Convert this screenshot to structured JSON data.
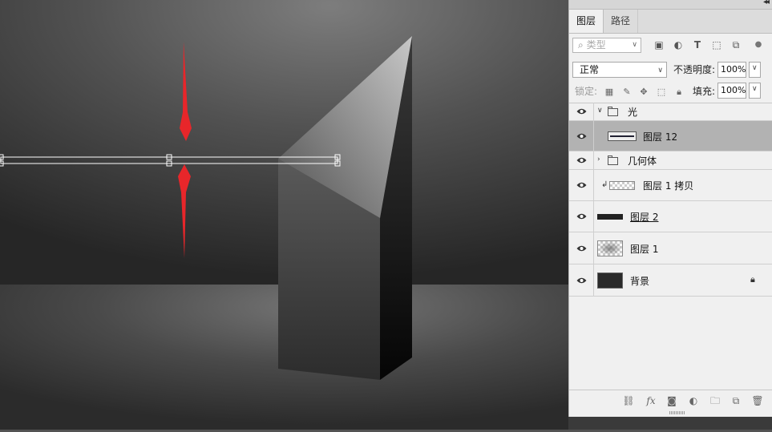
{
  "panel": {
    "tabs": [
      {
        "label": "图层",
        "active": true
      },
      {
        "label": "路径",
        "active": false
      }
    ],
    "filter": {
      "placeholder": "类型"
    },
    "blend_mode": "正常",
    "opacity_label": "不透明度:",
    "opacity_value": "100%",
    "lock_label": "锁定:",
    "fill_label": "填充:",
    "fill_value": "100%",
    "layers": [
      {
        "name": "光",
        "kind": "group",
        "expanded": true
      },
      {
        "name": "图层 12",
        "kind": "layer",
        "selected": true
      },
      {
        "name": "几何体",
        "kind": "group",
        "expanded": false
      },
      {
        "name": "图层 1 拷贝",
        "kind": "clipped-layer"
      },
      {
        "name": "图层 2",
        "kind": "layer"
      },
      {
        "name": "图层 1",
        "kind": "layer"
      },
      {
        "name": "背景",
        "kind": "background",
        "locked": true
      }
    ],
    "bottom_icons": [
      "link-icon",
      "fx-icon",
      "mask-icon",
      "adjustment-icon",
      "folder-icon",
      "new-layer-icon",
      "trash-icon"
    ]
  },
  "colors": {
    "annotation_arrow": "#e8262a",
    "light_line": "#4b63d8",
    "selected_layer": "#b2b2b2",
    "panel_bg": "#f0f0f0"
  }
}
